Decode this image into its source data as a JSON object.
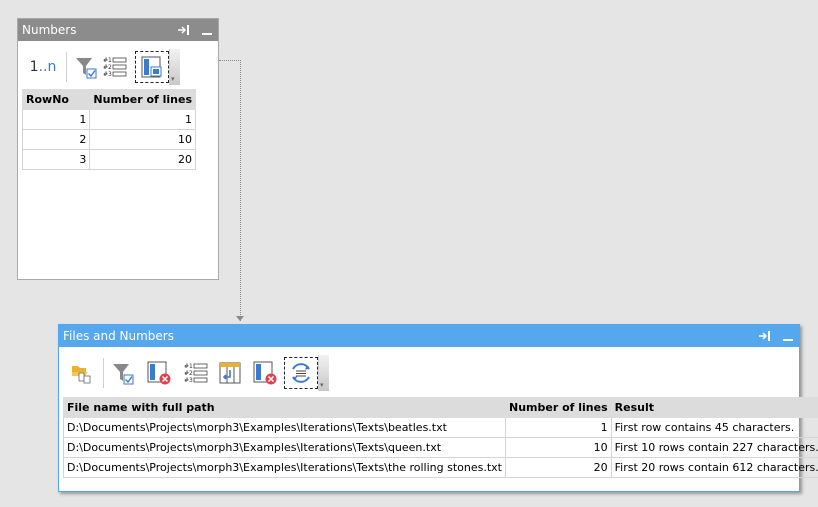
{
  "numbers_panel": {
    "title": "Numbers",
    "range_label_1": "1",
    "range_label_dots": "..",
    "range_label_n": "n",
    "columns": [
      "RowNo",
      "Number of lines"
    ],
    "rows": [
      [
        "1",
        "1"
      ],
      [
        "2",
        "10"
      ],
      [
        "3",
        "20"
      ]
    ]
  },
  "files_panel": {
    "title": "Files and Numbers",
    "columns": [
      "File name with full path",
      "Number of lines",
      "Result"
    ],
    "rows": [
      [
        "D:\\Documents\\Projects\\morph3\\Examples\\Iterations\\Texts\\beatles.txt",
        "1",
        "First row contains 45 characters."
      ],
      [
        "D:\\Documents\\Projects\\morph3\\Examples\\Iterations\\Texts\\queen.txt",
        "10",
        "First 10 rows contain 227 characters."
      ],
      [
        "D:\\Documents\\Projects\\morph3\\Examples\\Iterations\\Texts\\the rolling stones.txt",
        "20",
        "First 20 rows contain 612 characters."
      ]
    ]
  },
  "icons": {
    "numbers_toolbar": [
      "range-1-n-icon",
      "filter-icon",
      "numbered-list-icon",
      "column-select-icon"
    ],
    "files_toolbar": [
      "open-folder-icon",
      "filter-icon",
      "column-delete-icon",
      "numbered-list-icon",
      "insert-column-icon",
      "column-delete-icon",
      "loop-iterate-icon"
    ]
  },
  "colors": {
    "numbers_title_bg": "#8c8c8c",
    "files_title_bg": "#55a7ee",
    "accent": "#3a7ad0"
  }
}
